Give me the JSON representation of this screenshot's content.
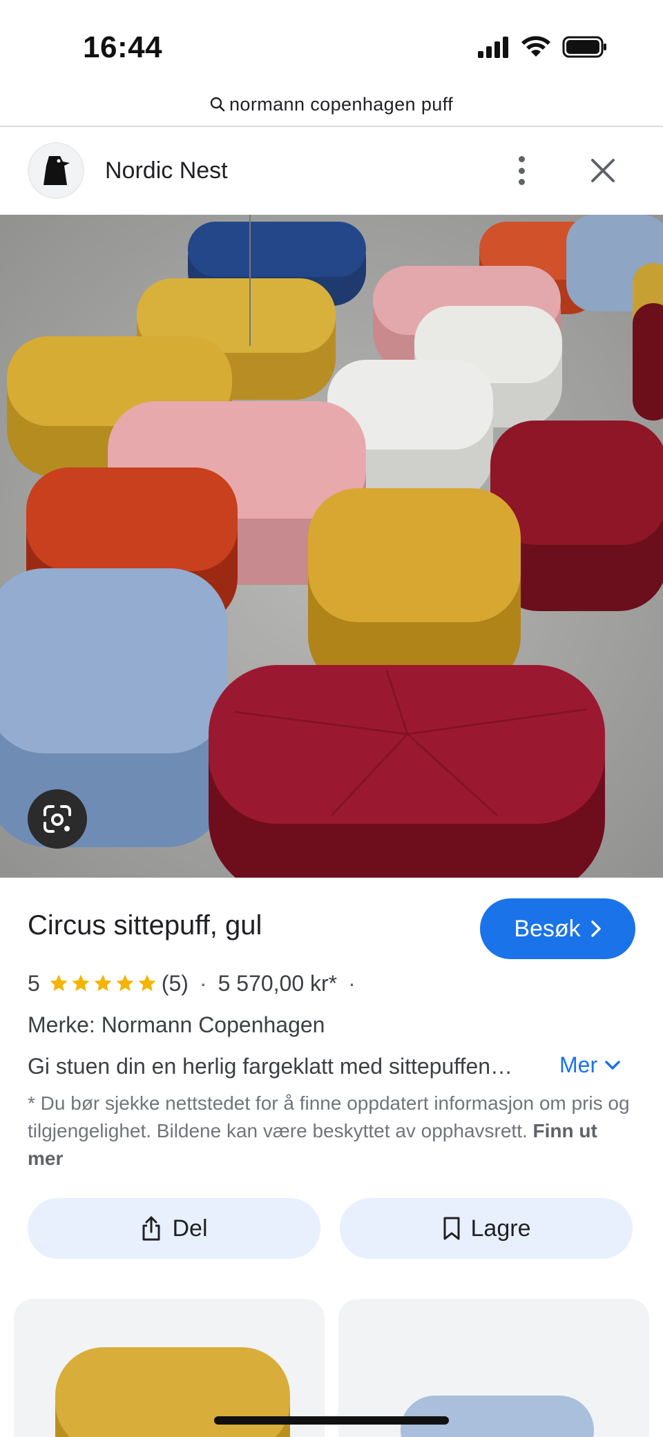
{
  "status_bar": {
    "time": "16:44"
  },
  "search": {
    "query": "normann copenhagen puff"
  },
  "source": {
    "name": "Nordic Nest"
  },
  "product": {
    "title": "Circus sittepuff, gul",
    "visit_label": "Besøk",
    "rating_value": "5",
    "stars": 5,
    "review_count": "(5)",
    "separator": "·",
    "price": "5 570,00 kr*",
    "brand": "Merke: Normann Copenhagen",
    "description": "Gi stuen din en herlig fargeklatt med sittepuffen…",
    "more_label": "Mer",
    "disclaimer_text": "* Du bør sjekke nettstedet for å finne oppdatert informasjon om pris og tilgjengelighet. Bildene kan være beskyttet av opphavsrett.",
    "learn_more_label": "Finn ut mer"
  },
  "actions": {
    "share_label": "Del",
    "save_label": "Lagre"
  },
  "colors": {
    "accent": "#1a73e8",
    "action_bg": "#e8f0fe",
    "star": "#f4b400",
    "text_secondary": "#70757a"
  },
  "icons": {
    "search": "search-icon",
    "signal": "cellular-signal-icon",
    "wifi": "wifi-icon",
    "battery": "battery-icon",
    "more": "more-vertical-icon",
    "close": "close-icon",
    "lens": "google-lens-icon",
    "chevron_right": "chevron-right-icon",
    "chevron_down": "chevron-down-icon",
    "share": "share-icon",
    "bookmark": "bookmark-icon"
  }
}
